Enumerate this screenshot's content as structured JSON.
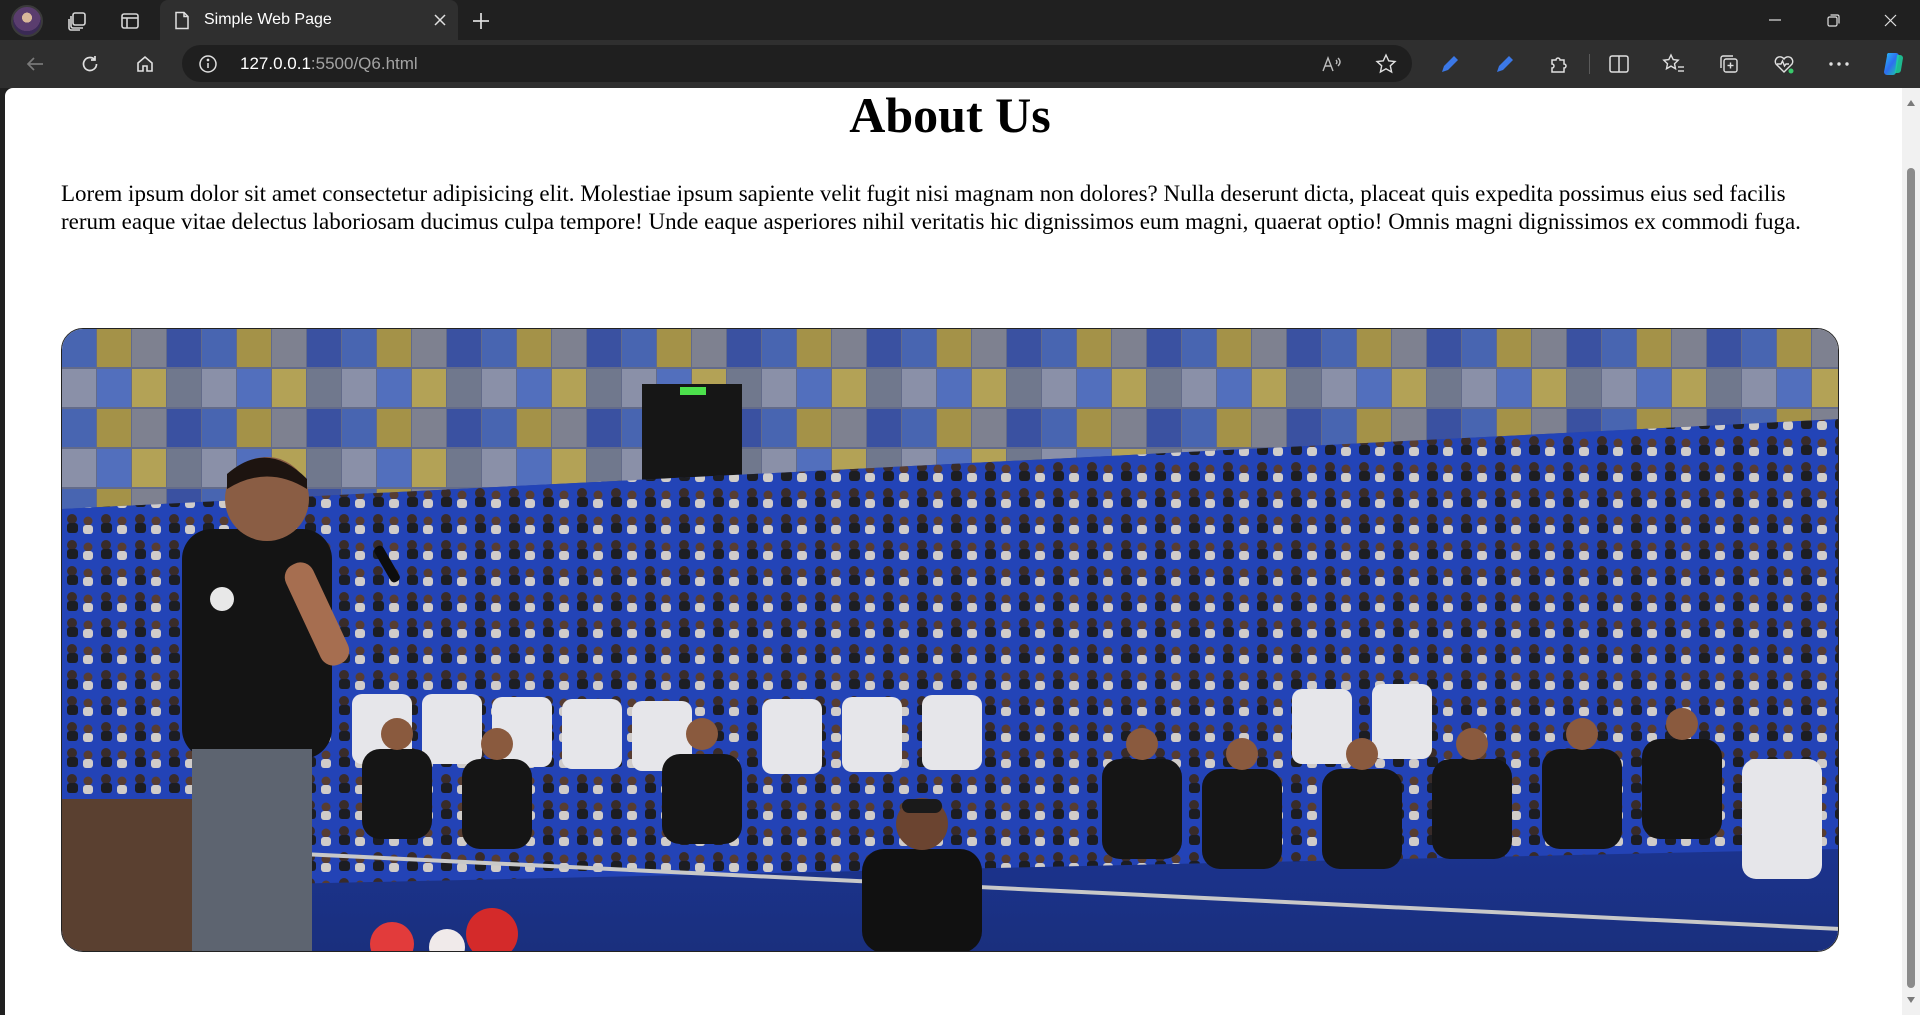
{
  "browser": {
    "tab_title": "Simple Web Page",
    "url_host": "127.0.0.1",
    "url_rest": ":5500/Q6.html"
  },
  "page": {
    "heading": "About Us",
    "paragraph": "Lorem ipsum dolor sit amet consectetur adipisicing elit. Molestiae ipsum sapiente velit fugit nisi magnam non dolores? Nulla deserunt dicta, placeat quis expedita possimus eius sed facilis rerum eaque vitae delectus laboriosam ducimus culpa tempore! Unde eaque asperiores nihil veritatis hic dignissimos eum magni, quaerat optio! Omnis magni dignissimos ex commodi fuga."
  },
  "icons": {
    "profile": "profile-avatar",
    "workspaces": "workspaces-icon",
    "tab_actions": "vertical-tabs-icon",
    "page": "page-icon",
    "close": "close-icon",
    "new_tab": "plus-icon",
    "back": "back-arrow-icon",
    "refresh": "refresh-icon",
    "home": "home-icon",
    "info": "info-icon",
    "read_aloud": "read-aloud-icon",
    "favorite": "star-icon",
    "extensions": "puzzle-icon",
    "copilot": "copilot-icon"
  },
  "colors": {
    "chrome_dark": "#202020",
    "toolbar": "#2f2f2f",
    "omnibox": "#1f1f1f",
    "accent_blue": "#3b78e7",
    "page_bg": "#ffffff"
  }
}
